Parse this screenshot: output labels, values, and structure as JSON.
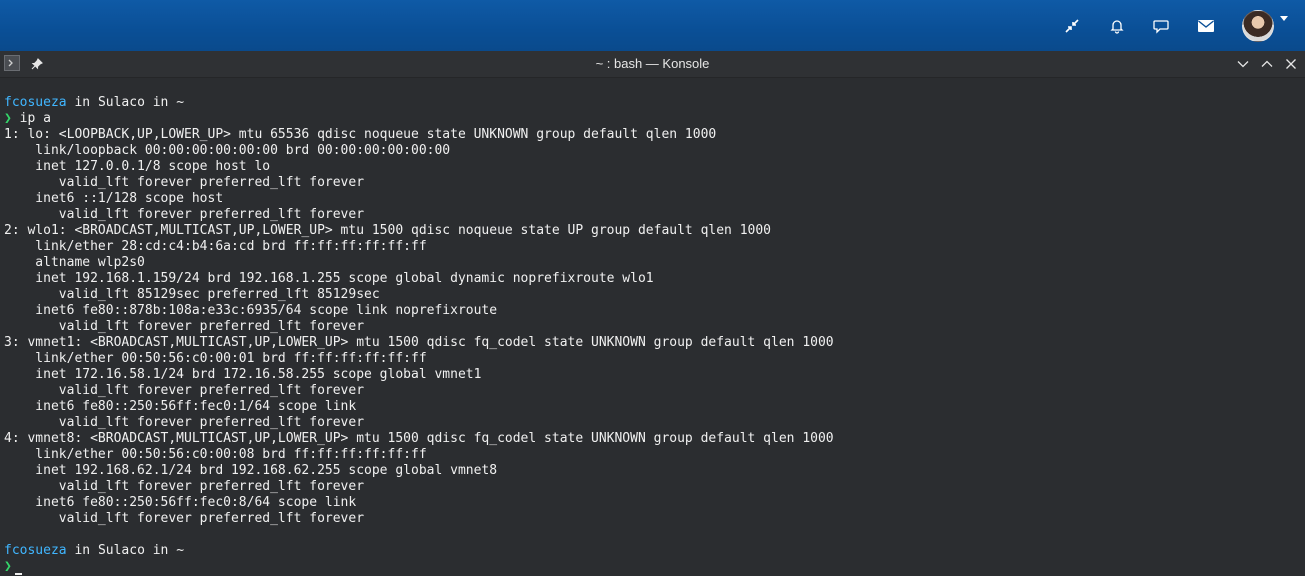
{
  "panel": {
    "icons": [
      "minimize-arrows-icon",
      "bell-icon",
      "chat-bubble-icon",
      "mail-icon"
    ],
    "avatar_label": "user-avatar"
  },
  "window": {
    "title": "~ : bash — Konsole"
  },
  "terminal": {
    "prompt1": {
      "user": "fcosueza",
      "in1": " in ",
      "host": "Sulaco",
      "in2": " in ",
      "dir": "~"
    },
    "prompt_symbol": "❯",
    "command": " ip a",
    "output": [
      "1: lo: <LOOPBACK,UP,LOWER_UP> mtu 65536 qdisc noqueue state UNKNOWN group default qlen 1000",
      "    link/loopback 00:00:00:00:00:00 brd 00:00:00:00:00:00",
      "    inet 127.0.0.1/8 scope host lo",
      "       valid_lft forever preferred_lft forever",
      "    inet6 ::1/128 scope host",
      "       valid_lft forever preferred_lft forever",
      "2: wlo1: <BROADCAST,MULTICAST,UP,LOWER_UP> mtu 1500 qdisc noqueue state UP group default qlen 1000",
      "    link/ether 28:cd:c4:b4:6a:cd brd ff:ff:ff:ff:ff:ff",
      "    altname wlp2s0",
      "    inet 192.168.1.159/24 brd 192.168.1.255 scope global dynamic noprefixroute wlo1",
      "       valid_lft 85129sec preferred_lft 85129sec",
      "    inet6 fe80::878b:108a:e33c:6935/64 scope link noprefixroute",
      "       valid_lft forever preferred_lft forever",
      "3: vmnet1: <BROADCAST,MULTICAST,UP,LOWER_UP> mtu 1500 qdisc fq_codel state UNKNOWN group default qlen 1000",
      "    link/ether 00:50:56:c0:00:01 brd ff:ff:ff:ff:ff:ff",
      "    inet 172.16.58.1/24 brd 172.16.58.255 scope global vmnet1",
      "       valid_lft forever preferred_lft forever",
      "    inet6 fe80::250:56ff:fec0:1/64 scope link",
      "       valid_lft forever preferred_lft forever",
      "4: vmnet8: <BROADCAST,MULTICAST,UP,LOWER_UP> mtu 1500 qdisc fq_codel state UNKNOWN group default qlen 1000",
      "    link/ether 00:50:56:c0:00:08 brd ff:ff:ff:ff:ff:ff",
      "    inet 192.168.62.1/24 brd 192.168.62.255 scope global vmnet8",
      "       valid_lft forever preferred_lft forever",
      "    inet6 fe80::250:56ff:fec0:8/64 scope link",
      "       valid_lft forever preferred_lft forever"
    ],
    "prompt2": {
      "user": "fcosueza",
      "in1": " in ",
      "host": "Sulaco",
      "in2": " in ",
      "dir": "~"
    }
  },
  "colors": {
    "panel": "#0a4f96",
    "terminal_bg": "#2b2d30",
    "user": "#40b6ff",
    "prompt_arrow": "#34d66a"
  }
}
